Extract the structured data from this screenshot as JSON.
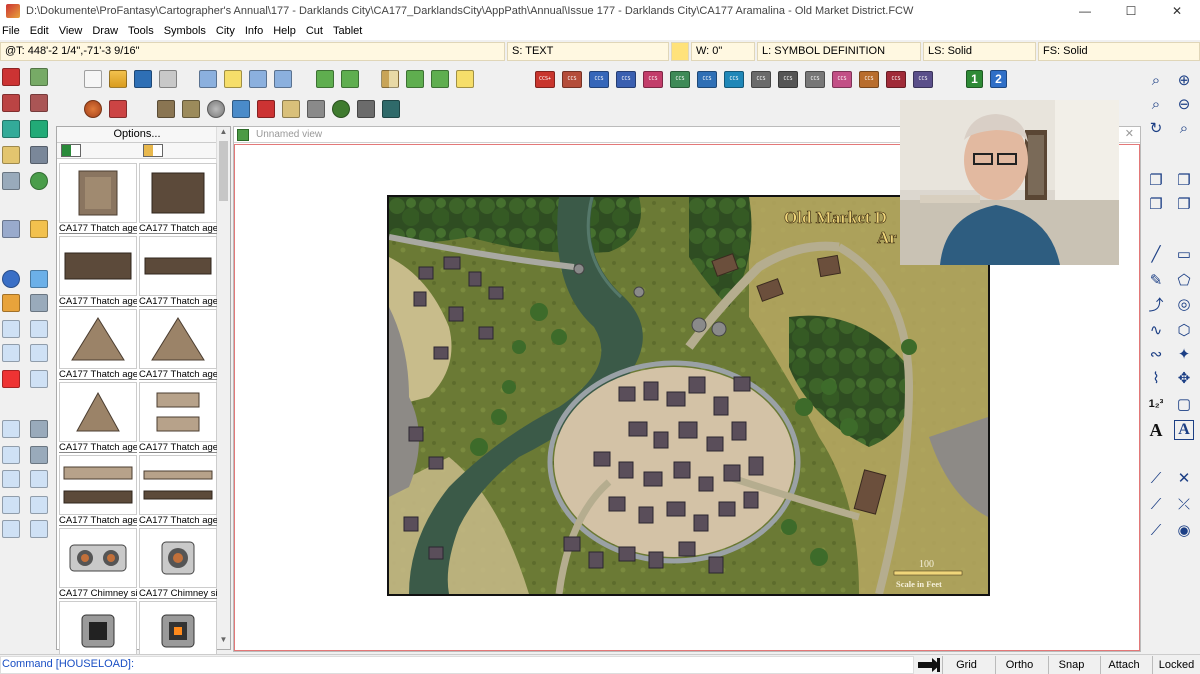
{
  "window": {
    "title": "D:\\Dokumente\\ProFantasy\\Cartographer's Annual\\177 - Darklands City\\CA177_DarklandsCity\\AppPath\\Annual\\Issue 177 - Darklands City\\CA177 Aramalina - Old Market District.FCW",
    "minimize": "—",
    "maximize": "☐",
    "close": "✕"
  },
  "menu": [
    "File",
    "Edit",
    "View",
    "Draw",
    "Tools",
    "Symbols",
    "City",
    "Info",
    "Help",
    "Cut",
    "Tablet"
  ],
  "props": {
    "coords": "@T: 448'-2 1/4\",-71'-3 9/16\"",
    "sheet": "S: TEXT",
    "width": "W: 0\"",
    "layer": "L: SYMBOL DEFINITION",
    "line_style": "LS: Solid",
    "fill_style": "FS: Solid"
  },
  "toolbar_labels": {
    "ccs": [
      "CCS+",
      "CCS",
      "CCS",
      "CCS",
      "CCS",
      "CCS",
      "CCS",
      "CCS",
      "CCS",
      "CCS",
      "CCS",
      "CCS",
      "CCS",
      "CCS",
      "CCS"
    ],
    "sheets_one": "1",
    "sheets_two": "2"
  },
  "catalog": {
    "options_label": "Options...",
    "items": [
      {
        "label": "CA177 Thatch age",
        "kind": "thatch-block"
      },
      {
        "label": "CA177 Thatch age",
        "kind": "thatch-square"
      },
      {
        "label": "CA177 Thatch age",
        "kind": "thatch-wide"
      },
      {
        "label": "CA177 Thatch age",
        "kind": "thatch-wide-thin"
      },
      {
        "label": "CA177 Thatch age",
        "kind": "thatch-cone"
      },
      {
        "label": "CA177 Thatch age",
        "kind": "thatch-cone"
      },
      {
        "label": "CA177 Thatch age",
        "kind": "thatch-cone-small"
      },
      {
        "label": "CA177 Thatch age",
        "kind": "thatch-strips"
      },
      {
        "label": "CA177 Thatch age",
        "kind": "thatch-long"
      },
      {
        "label": "CA177 Thatch age",
        "kind": "thatch-long-thin"
      },
      {
        "label": "CA177 Chimney si",
        "kind": "chimney-double"
      },
      {
        "label": "CA177 Chimney si",
        "kind": "chimney-single"
      },
      {
        "label": "",
        "kind": "chimney-dark"
      },
      {
        "label": "",
        "kind": "chimney-fire"
      }
    ]
  },
  "view": {
    "name": "Unnamed view"
  },
  "map": {
    "title_line1": "Old Market D",
    "title_line2": "Ar",
    "scale_value": "100",
    "scale_label": "Scale in Feet"
  },
  "command": {
    "prompt": "Command [HOUSELOAD]:"
  },
  "status_buttons": [
    "Grid",
    "Ortho",
    "Snap",
    "Attach",
    "Locked"
  ],
  "colors": {
    "accent": "#1a4fc4",
    "canvas_border": "#e37878",
    "prop_bg": "#fff8e1"
  }
}
